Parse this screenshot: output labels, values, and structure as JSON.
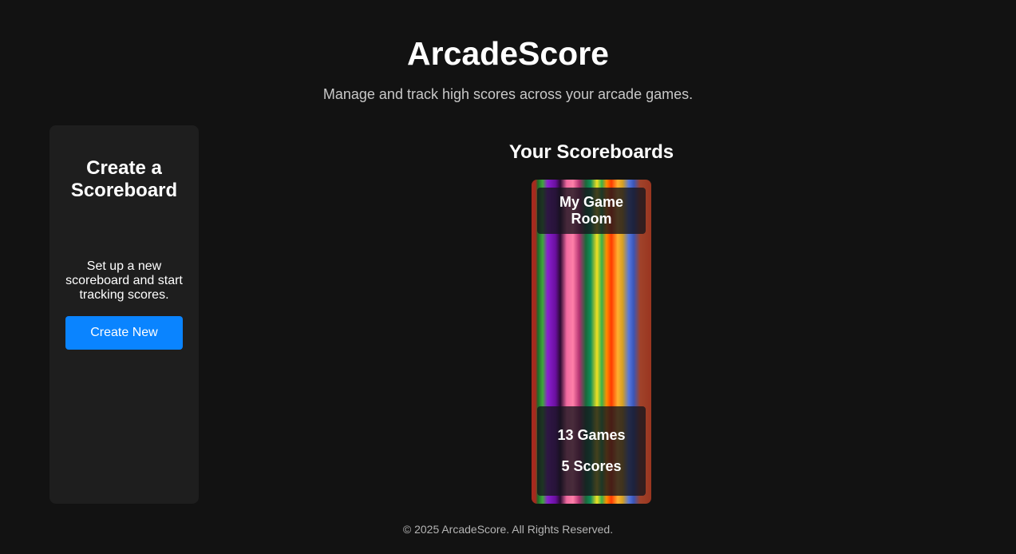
{
  "header": {
    "title": "ArcadeScore",
    "subtitle": "Manage and track high scores across your arcade games."
  },
  "create_panel": {
    "title": "Create a Scoreboard",
    "description": "Set up a new scoreboard and start tracking scores.",
    "button_label": "Create New"
  },
  "scoreboards": {
    "heading": "Your Scoreboards",
    "items": [
      {
        "name": "My Game Room",
        "games": "13 Games",
        "scores": "5 Scores"
      }
    ]
  },
  "footer": {
    "text": "© 2025 ArcadeScore. All Rights Reserved."
  },
  "colors": {
    "background": "#121212",
    "panel": "#1e1e1e",
    "accent": "#0a84ff",
    "text": "#ffffff",
    "muted_text": "#c8c8c8"
  }
}
